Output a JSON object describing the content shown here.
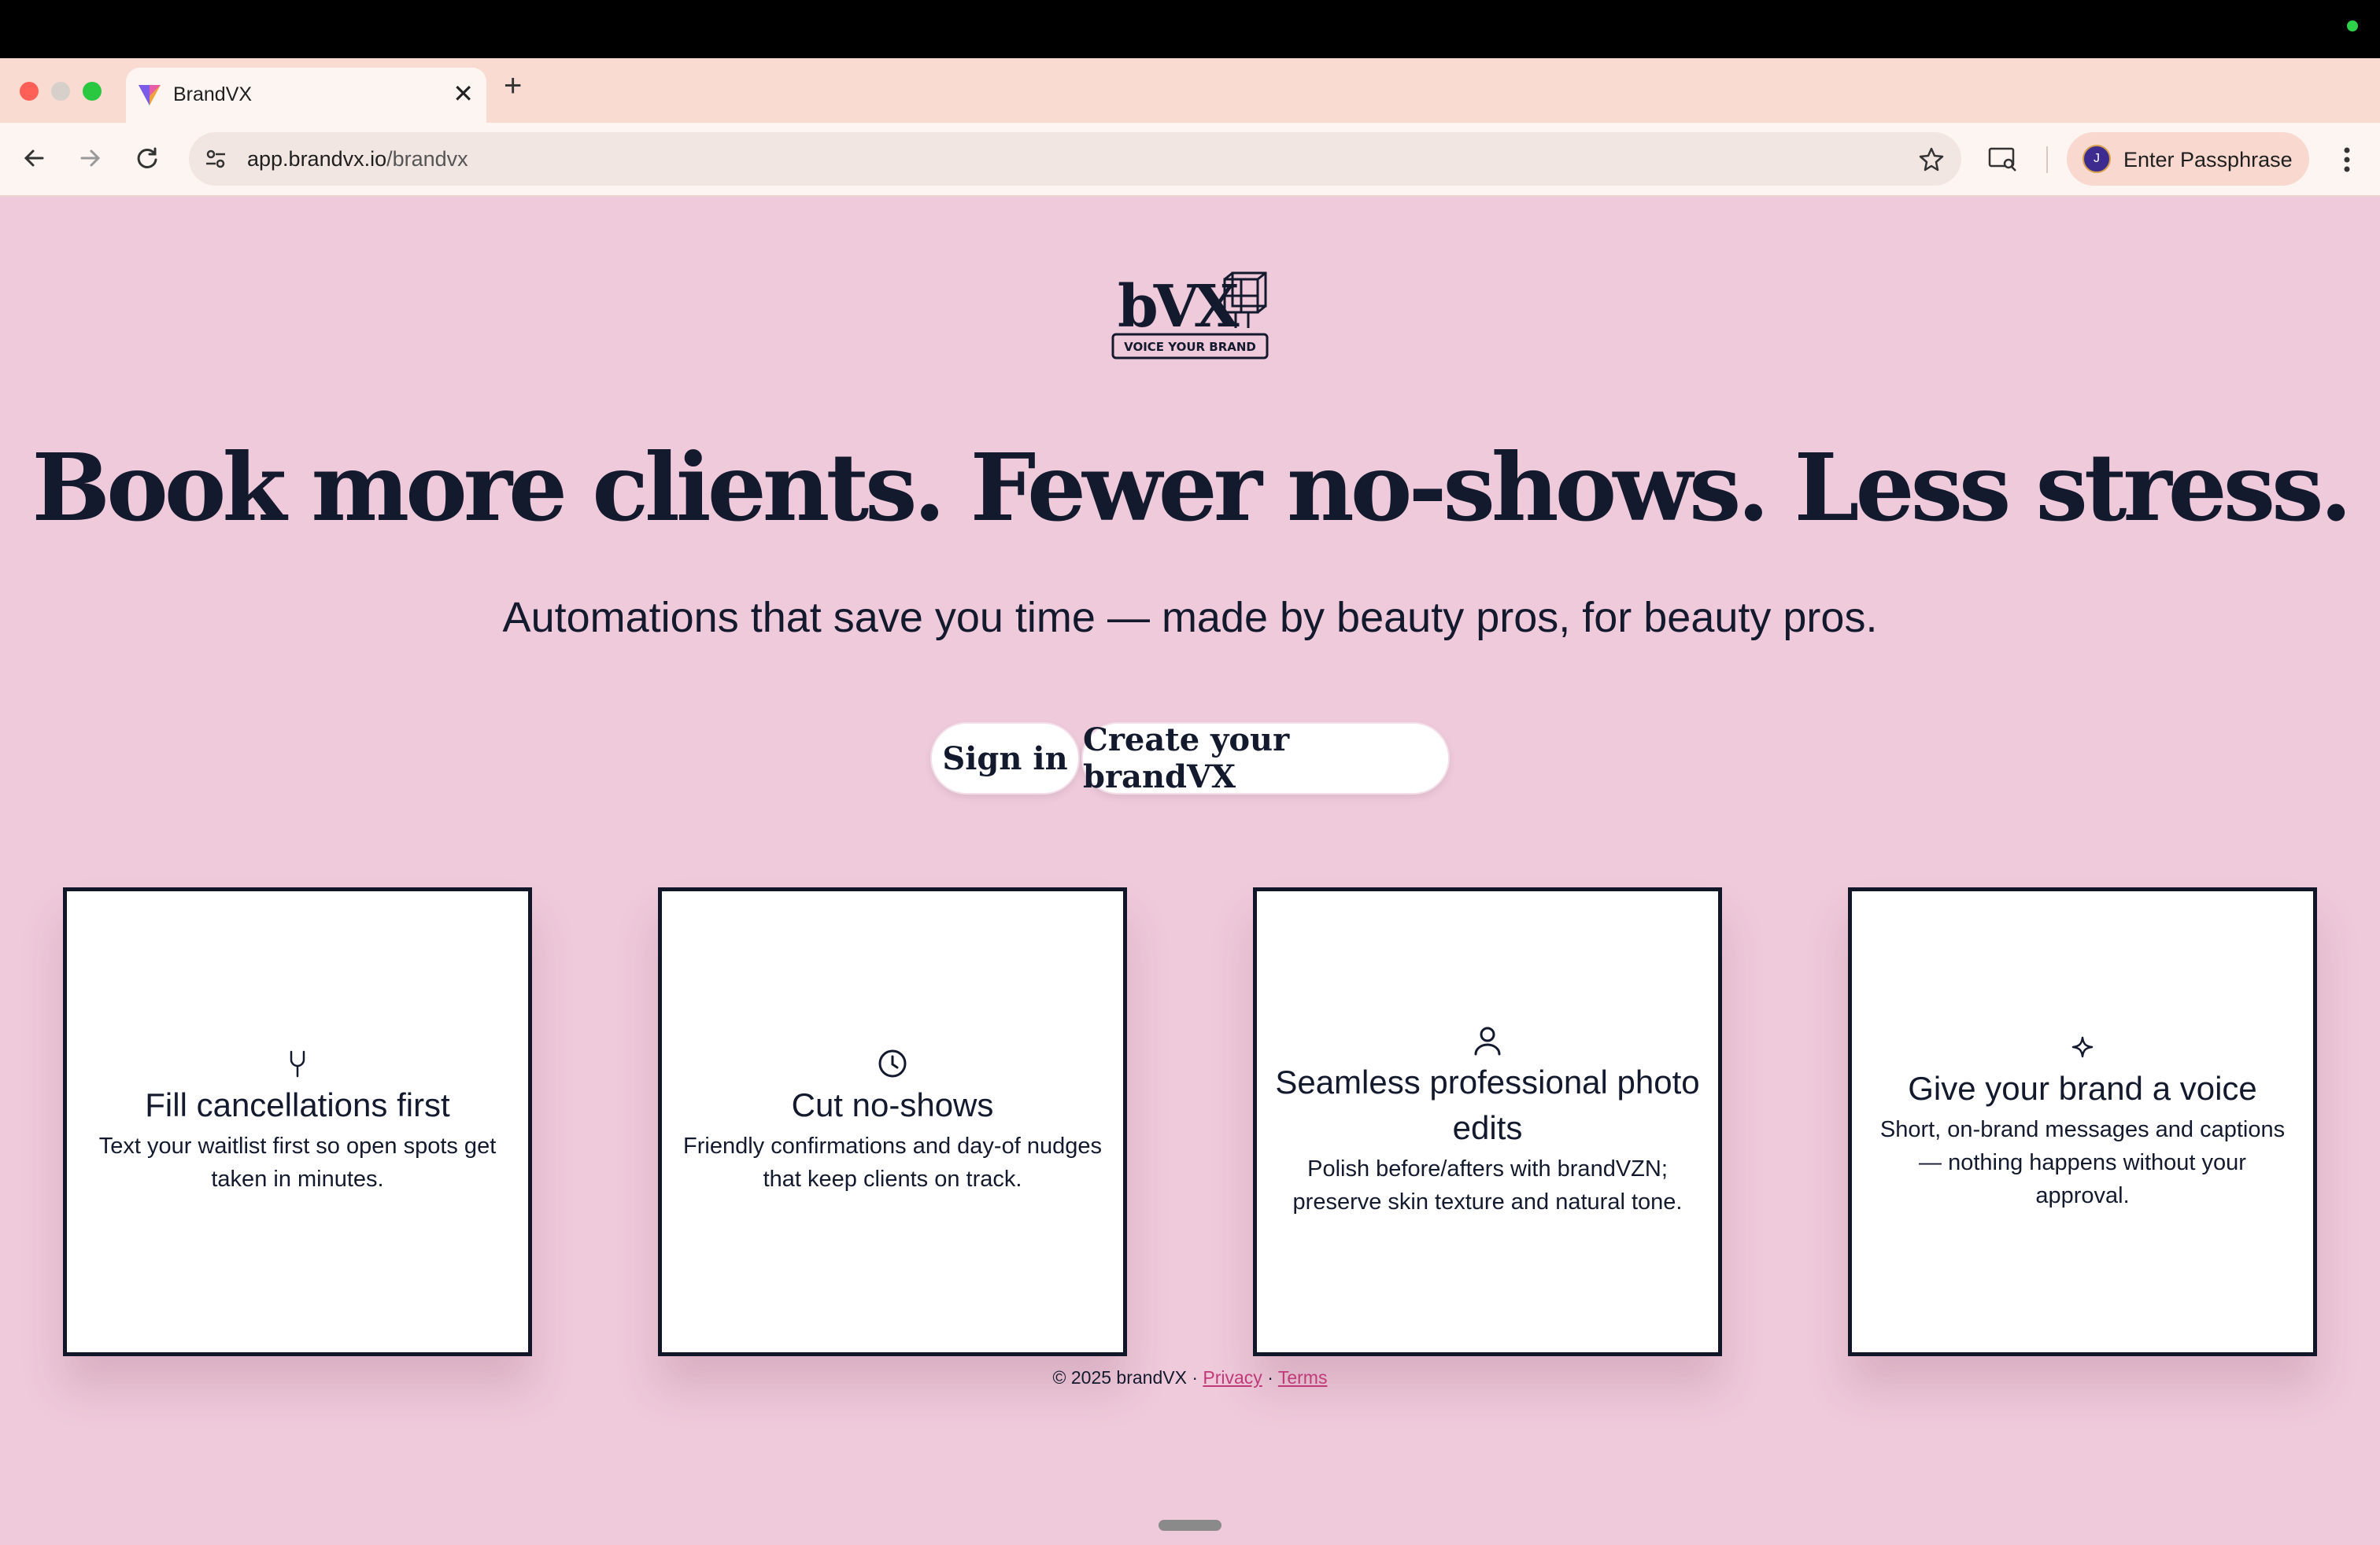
{
  "browser": {
    "tab": {
      "title": "BrandVX"
    },
    "url": {
      "host": "app.brandvx.io",
      "path": "/brandvx"
    },
    "profile": {
      "initial": "J",
      "label": "Enter Passphrase"
    }
  },
  "logo": {
    "wordmark": "bVX",
    "tagline": "VOICE YOUR BRAND"
  },
  "hero": {
    "headline": "Book more clients. Fewer no-shows. Less stress.",
    "subheadline": "Automations that save you time — made by beauty pros, for beauty pros."
  },
  "actions": {
    "signin_label": "Sign in",
    "create_label": "Create your brandVX"
  },
  "features": [
    {
      "icon": "fork-icon",
      "title": "Fill cancellations first",
      "description": "Text your waitlist first so open spots get taken in minutes."
    },
    {
      "icon": "clock-icon",
      "title": "Cut no-shows",
      "description": "Friendly confirmations and day-of nudges that keep clients on track."
    },
    {
      "icon": "person-icon",
      "title": "Seamless professional photo edits",
      "description": "Polish before/afters with brandVZN; preserve skin texture and natural tone."
    },
    {
      "icon": "sparkle-icon",
      "title": "Give your brand a voice",
      "description": "Short, on-brand messages and captions — nothing happens without your approval."
    }
  ],
  "footer": {
    "copyright": "© 2025 brandVX",
    "separator": "·",
    "privacy_label": "Privacy",
    "terms_label": "Terms"
  },
  "colors": {
    "page_background": "#efcadb",
    "ink": "#141a2e",
    "link": "#c03a78",
    "card_border": "#121629"
  }
}
